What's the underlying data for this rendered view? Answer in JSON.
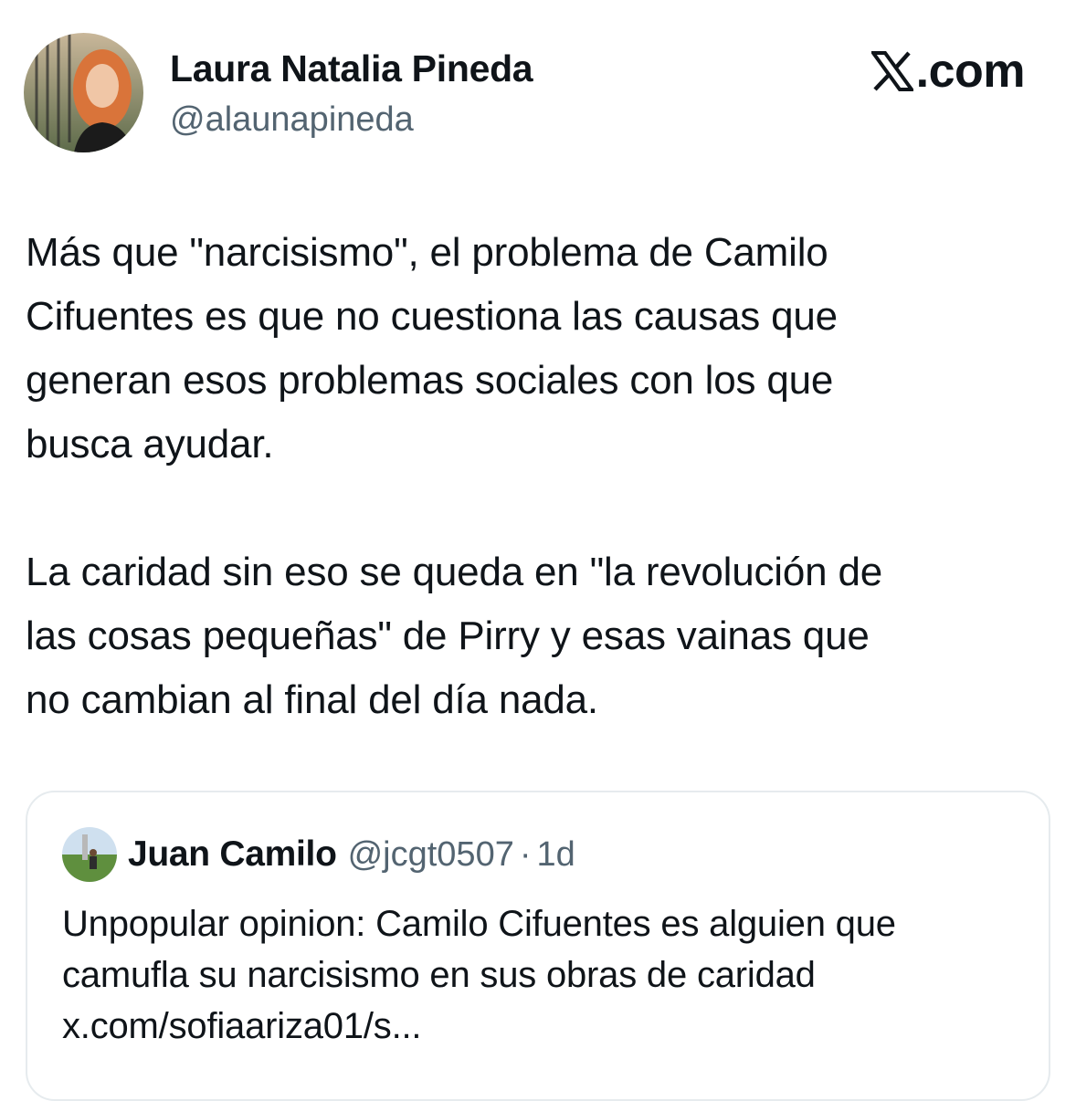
{
  "author": {
    "name": "Laura Natalia Pineda",
    "handle": "@alaunapineda",
    "avatar_icon": "profile-photo"
  },
  "brand": {
    "icon": "x-logo-icon",
    "text": ".com"
  },
  "tweet": {
    "paragraphs": [
      "Más que \"narcisismo\", el problema de Camilo\nCifuentes es que no cuestiona las causas que\ngeneran esos problemas sociales con los que\nbusca ayudar.",
      "La caridad sin eso se queda en \"la revolución de\nlas cosas pequeñas\" de Pirry y esas vainas que\nno cambian al final del día nada."
    ]
  },
  "quoted_tweet": {
    "name": "Juan Camilo",
    "handle": "@jcgt0507",
    "separator": "·",
    "time": "1d",
    "avatar_icon": "profile-photo",
    "lines": [
      "Unpopular opinion: Camilo Cifuentes es alguien que",
      "camufla su narcisismo en sus obras de caridad",
      "x.com/sofiaariza01/s..."
    ]
  },
  "colors": {
    "text": "#0f1419",
    "secondary": "#536471",
    "border": "#e6ebee"
  }
}
